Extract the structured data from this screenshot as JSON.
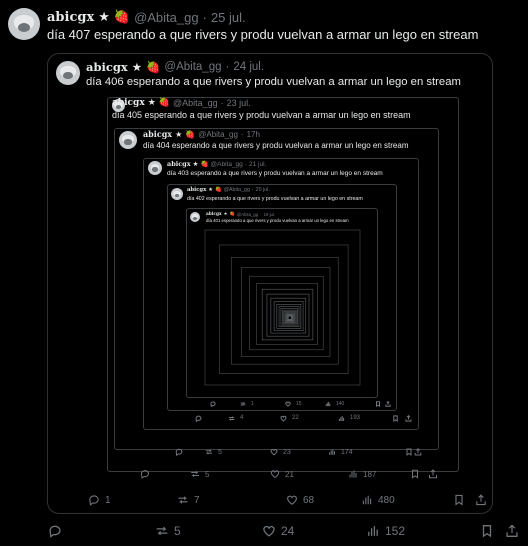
{
  "author": {
    "display_name": "abicgx",
    "star": "★",
    "berry": "🍓",
    "handle": "@Abita_gg",
    "dot": "·"
  },
  "level0": {
    "date": "25 jul.",
    "text": "día 407 esperando a que rivers y produ vuelvan a armar un lego en stream",
    "actions": {
      "replies": "",
      "reposts": "5",
      "likes": "24",
      "views": "152"
    }
  },
  "level1": {
    "date": "24 jul.",
    "text": "día 406 esperando a que rivers y produ vuelvan a armar un lego en stream",
    "actions": {
      "replies": "1",
      "reposts": "7",
      "likes": "68",
      "views": "480"
    }
  },
  "level2": {
    "date": "23 jul.",
    "text": "día 405 esperando a que rivers y produ vuelvan a armar un lego en stream",
    "actions": {
      "replies": "",
      "reposts": "5",
      "likes": "21",
      "views": "187"
    }
  },
  "level3": {
    "date": "17h",
    "text": "día 404 esperando a que rivers y produ vuelvan a armar un lego en stream",
    "actions": {
      "replies": "",
      "reposts": "5",
      "likes": "23",
      "views": "174"
    }
  },
  "level4": {
    "date": "21 jul.",
    "text": "día 403 esperando a que rivers y produ vuelvan a armar un lego en stream",
    "actions": {
      "replies": "",
      "reposts": "4",
      "likes": "22",
      "views": "193"
    }
  },
  "level5": {
    "date": "20 jul.",
    "text": "día 402 esperando a que rivers y produ vuelvan a armar un lego en stream",
    "actions": {
      "replies": "",
      "reposts": "1",
      "likes": "15",
      "views": "140"
    }
  },
  "level6": {
    "date": "19 jul.",
    "text": "día 401 esperando a que rivers y produ vuelvan a armar un lego en stream"
  }
}
